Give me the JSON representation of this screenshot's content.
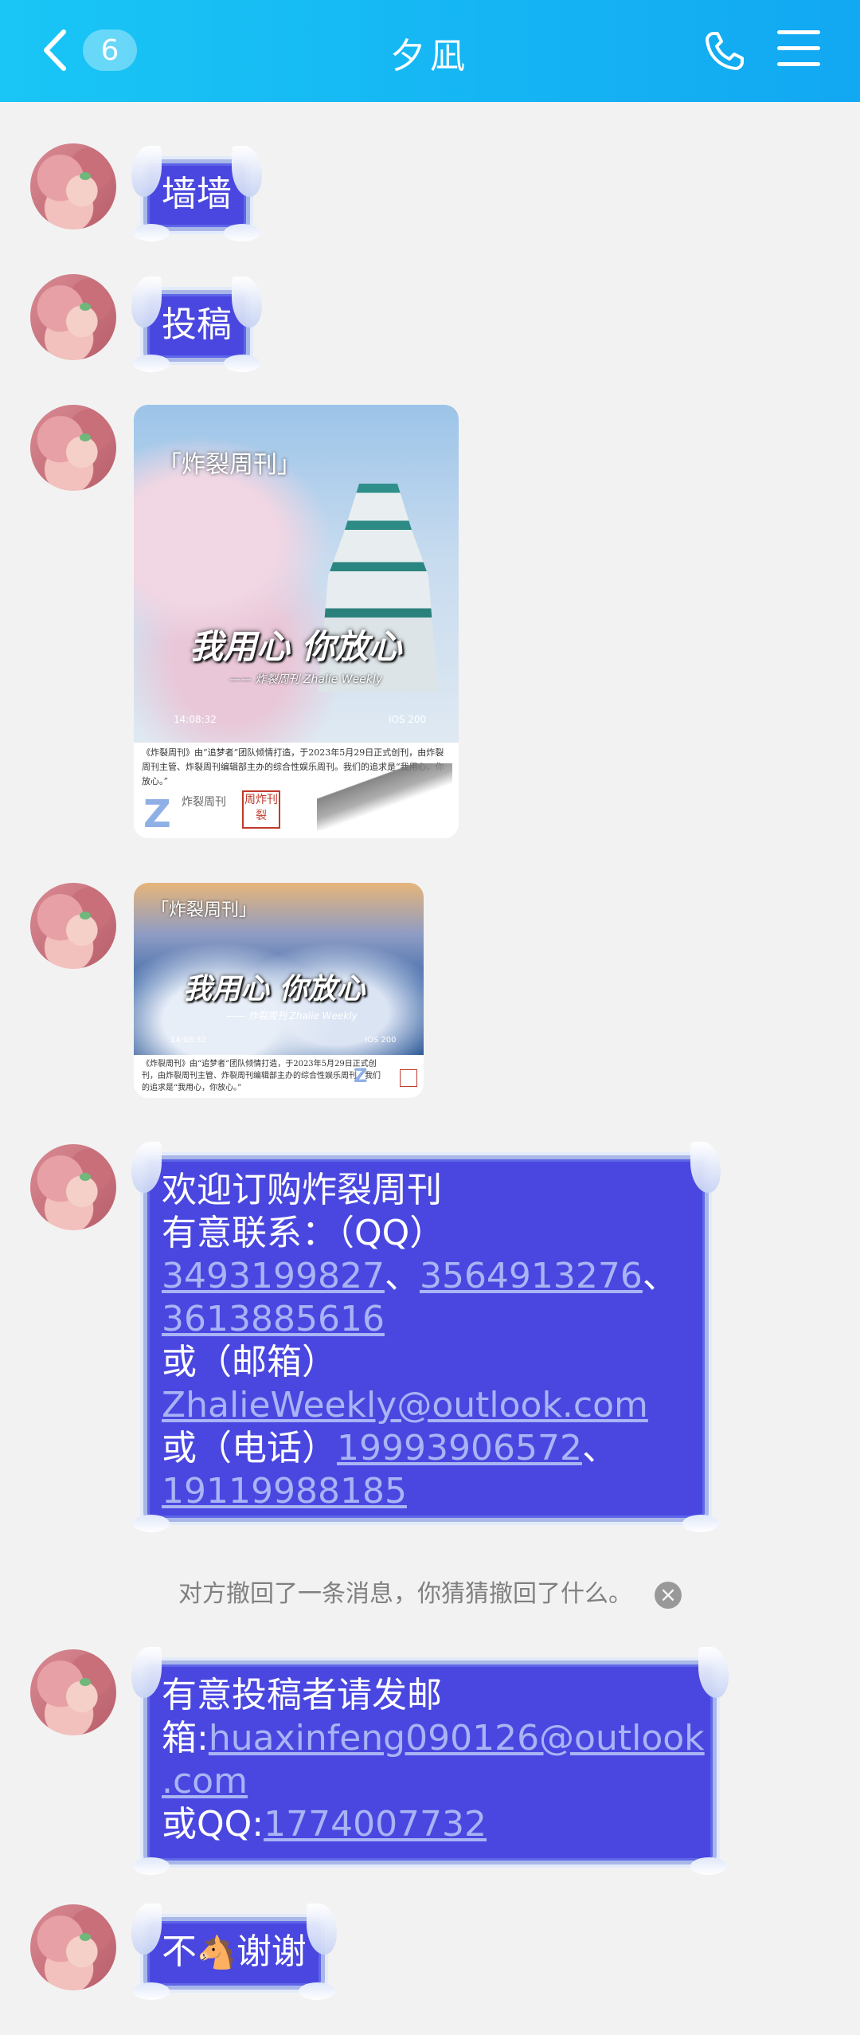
{
  "header": {
    "title": "夕凪",
    "unread_count": "6"
  },
  "messages": [
    {
      "type": "text",
      "text": "墙墙"
    },
    {
      "type": "text",
      "text": "投稿"
    },
    {
      "type": "image",
      "overlay_title": "「炸裂周刊」",
      "slogan": "我用心 你放心",
      "sub": "—— 炸裂周刊 Zhalie Weekly",
      "time": "14:08:32",
      "iso": "IOS 200",
      "caption": "《炸裂周刊》由“追梦者”团队倾情打造，于2023年5月29日正式创刊，由炸裂周刊主管、炸裂周刊编辑部主办的综合性娱乐周刊。我们的追求是“我用心，你放心。”",
      "logo_text": "炸裂周刊",
      "seal_text": "周炸刊裂"
    },
    {
      "type": "image",
      "overlay_title": "「炸裂周刊」",
      "slogan": "我用心 你放心",
      "sub": "—— 炸裂周刊 Zhalie Weekly",
      "time": "14:08:32",
      "iso": "IOS 200",
      "caption": "《炸裂周刊》由“追梦者”团队倾情打造，于2023年5月29日正式创刊，由炸裂周刊主管、炸裂周刊编辑部主办的综合性娱乐周刊。我们的追求是“我用心，你放心。”"
    },
    {
      "type": "text",
      "line1": "欢迎订购炸裂周刊",
      "line2": "有意联系：（QQ）",
      "qq1": "3493199827",
      "sep1": "、",
      "qq2": "3564913276",
      "sep2": "、",
      "qq3": "3613885616",
      "line_email": "或（邮箱）",
      "email": "ZhalieWeekly@outlook.com",
      "line_phone": "或（电话）",
      "phone1": "19993906572",
      "sep3": "、",
      "phone2": "19119988185"
    },
    {
      "type": "text",
      "line1": "有意投稿者请发邮",
      "line2_prefix": "箱:",
      "email_a": "huaxinfeng090126@outlook",
      "email_b": ".com",
      "qq_prefix": "或QQ:",
      "qq": "1774007732"
    },
    {
      "type": "text",
      "pre": "不",
      "emoji": "🐴",
      "post": "谢谢"
    }
  ],
  "recall_notice": "对方撤回了一条消息，你猜猜撤回了什么。",
  "recall_close": "×"
}
